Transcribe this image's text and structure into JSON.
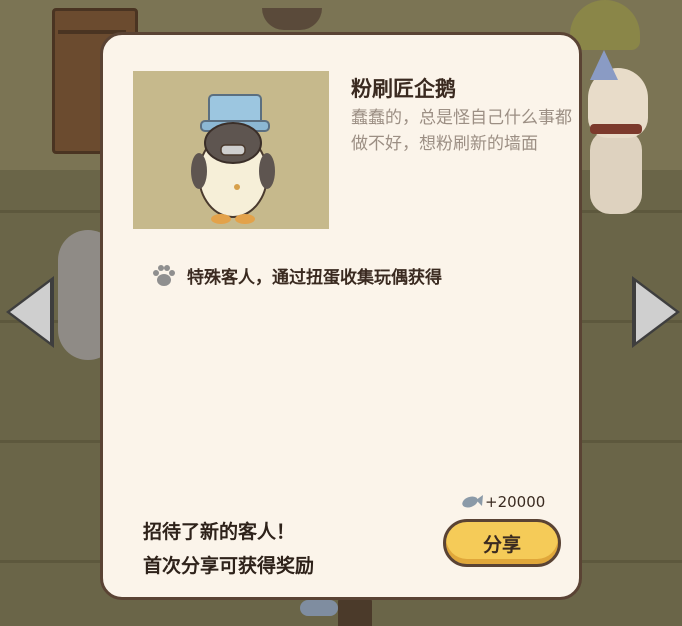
{
  "card": {
    "title": "粉刷匠企鹅",
    "description": "蠢蠢的，总是怪自己什么事都做不好，想粉刷新的墙面",
    "special_text": "特殊客人，通过扭蛋收集玩偶获得",
    "reward_text": "+20000",
    "message_line1": "招待了新的客人！",
    "message_line2": "首次分享可获得奖励",
    "share_label": "分享"
  },
  "icons": {
    "paw": "paw-icon",
    "reward": "fish-icon",
    "prev": "arrow-left-icon",
    "next": "arrow-right-icon"
  },
  "colors": {
    "card_bg": "#fbf4ea",
    "card_border": "#5a4334",
    "button": "#f5cb58",
    "portrait_bg": "#c6b98c",
    "desc_text": "#9c8f84"
  }
}
